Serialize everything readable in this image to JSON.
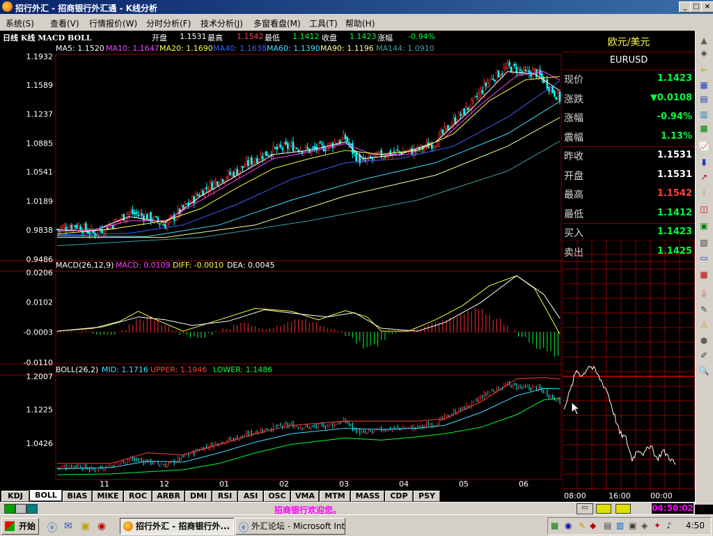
{
  "window": {
    "title": "招行外汇 - 招商银行外汇通 - K线分析",
    "controls": [
      "_",
      "□",
      "×"
    ]
  },
  "menu": [
    {
      "label": "系统(S)"
    },
    {
      "label": "查看(V)"
    },
    {
      "label": "行情报价(W)"
    },
    {
      "label": "分时分析(F)"
    },
    {
      "label": "技术分析(J)"
    },
    {
      "label": "多窗看盘(M)"
    },
    {
      "label": "工具(T)"
    },
    {
      "label": "帮助(H)"
    }
  ],
  "chart_header": {
    "title": "日线 K线 MACD BOLL",
    "open_label": "开盘",
    "open": "1.1531",
    "high_label": "最高",
    "high": "1.1542",
    "low_label": "最低",
    "low": "1.1412",
    "close_label": "收盘",
    "close": "1.1423",
    "change_label": "涨幅",
    "change": "-0.94%"
  },
  "colors": {
    "up": "#ff3030",
    "down": "#00ffff",
    "ma5": "#ffffff",
    "ma10": "#ff40ff",
    "ma20": "#ffff40",
    "ma40": "#4060ff",
    "ma60": "#40e0ff",
    "ma90": "#ffffa0",
    "ma144": "#40a0a0",
    "grid": "#8b0000",
    "green": "#00ff40",
    "red_text": "#ff4040"
  },
  "ma_legend": [
    {
      "label": "MA5: 1.1520",
      "color": "#ffffff"
    },
    {
      "label": "MA10: 1.1647",
      "color": "#ff40ff"
    },
    {
      "label": "MA20: 1.1690",
      "color": "#ffff40"
    },
    {
      "label": "MA40: 1.1638",
      "color": "#4060ff"
    },
    {
      "label": "MA60: 1.1390",
      "color": "#40e0ff"
    },
    {
      "label": "MA90: 1.1196",
      "color": "#ffffa0"
    },
    {
      "label": "MA144: 1.0910",
      "color": "#40a0a0"
    }
  ],
  "macd_legend": {
    "name": "MACD(26,12,9)",
    "macd": "MACD: 0.0109",
    "diff": "DIFF: -0.0010",
    "dea": "DEA: 0.0045"
  },
  "boll_legend": {
    "name": "BOLL(26,2)",
    "mid": "MID: 1.1716",
    "upper": "UPPER: 1.1946",
    "lower": "LOWER: 1.1486"
  },
  "chart_data": [
    {
      "type": "candlestick",
      "title": "日线 K线",
      "yticks": [
        "1.1932",
        "1.1589",
        "1.1237",
        "1.0885",
        "1.0541",
        "1.0189",
        "0.9838",
        "0.9486"
      ],
      "ylim": [
        0.9486,
        1.1932
      ],
      "close_points": [
        [
          0,
          0.985
        ],
        [
          10,
          0.99
        ],
        [
          20,
          0.98
        ],
        [
          30,
          0.99
        ],
        [
          40,
          1.005
        ],
        [
          50,
          1.0
        ],
        [
          60,
          0.99
        ],
        [
          70,
          1.01
        ],
        [
          80,
          1.03
        ],
        [
          90,
          1.045
        ],
        [
          100,
          1.055
        ],
        [
          110,
          1.07
        ],
        [
          120,
          1.08
        ],
        [
          130,
          1.085
        ],
        [
          140,
          1.08
        ],
        [
          150,
          1.085
        ],
        [
          160,
          1.095
        ],
        [
          165,
          1.075
        ],
        [
          170,
          1.065
        ],
        [
          180,
          1.075
        ],
        [
          190,
          1.078
        ],
        [
          200,
          1.08
        ],
        [
          210,
          1.09
        ],
        [
          220,
          1.115
        ],
        [
          230,
          1.135
        ],
        [
          240,
          1.165
        ],
        [
          250,
          1.18
        ],
        [
          255,
          1.178
        ],
        [
          260,
          1.172
        ],
        [
          265,
          1.175
        ],
        [
          270,
          1.165
        ],
        [
          275,
          1.152
        ],
        [
          279,
          1.1423
        ]
      ],
      "ma_lines": [
        {
          "name": "MA5",
          "points": [
            [
              0,
              0.984
            ],
            [
              20,
              0.983
            ],
            [
              40,
              1.0
            ],
            [
              60,
              0.993
            ],
            [
              80,
              1.025
            ],
            [
              100,
              1.05
            ],
            [
              120,
              1.075
            ],
            [
              140,
              1.08
            ],
            [
              160,
              1.09
            ],
            [
              170,
              1.07
            ],
            [
              190,
              1.075
            ],
            [
              210,
              1.09
            ],
            [
              230,
              1.13
            ],
            [
              250,
              1.175
            ],
            [
              265,
              1.172
            ],
            [
              279,
              1.152
            ]
          ]
        },
        {
          "name": "MA10",
          "points": [
            [
              0,
              0.982
            ],
            [
              20,
              0.984
            ],
            [
              40,
              0.995
            ],
            [
              60,
              0.995
            ],
            [
              80,
              1.02
            ],
            [
              100,
              1.045
            ],
            [
              120,
              1.07
            ],
            [
              140,
              1.078
            ],
            [
              160,
              1.088
            ],
            [
              175,
              1.075
            ],
            [
              195,
              1.075
            ],
            [
              215,
              1.095
            ],
            [
              235,
              1.135
            ],
            [
              255,
              1.17
            ],
            [
              270,
              1.175
            ],
            [
              279,
              1.1647
            ]
          ]
        },
        {
          "name": "MA20",
          "points": [
            [
              0,
              0.979
            ],
            [
              30,
              0.985
            ],
            [
              60,
              0.995
            ],
            [
              80,
              1.01
            ],
            [
              100,
              1.035
            ],
            [
              120,
              1.058
            ],
            [
              140,
              1.07
            ],
            [
              160,
              1.08
            ],
            [
              180,
              1.075
            ],
            [
              200,
              1.08
            ],
            [
              220,
              1.1
            ],
            [
              240,
              1.14
            ],
            [
              260,
              1.165
            ],
            [
              279,
              1.169
            ]
          ]
        },
        {
          "name": "MA40",
          "points": [
            [
              0,
              0.978
            ],
            [
              40,
              0.98
            ],
            [
              70,
              0.99
            ],
            [
              100,
              1.015
            ],
            [
              130,
              1.045
            ],
            [
              160,
              1.065
            ],
            [
              190,
              1.07
            ],
            [
              220,
              1.085
            ],
            [
              250,
              1.12
            ],
            [
              279,
              1.1638
            ]
          ]
        },
        {
          "name": "MA60",
          "points": [
            [
              0,
              0.977
            ],
            [
              50,
              0.976
            ],
            [
              90,
              0.99
            ],
            [
              130,
              1.02
            ],
            [
              170,
              1.045
            ],
            [
              210,
              1.065
            ],
            [
              250,
              1.1
            ],
            [
              279,
              1.139
            ]
          ]
        },
        {
          "name": "MA90",
          "points": [
            [
              0,
              0.975
            ],
            [
              60,
              0.975
            ],
            [
              110,
              0.99
            ],
            [
              160,
              1.025
            ],
            [
              210,
              1.05
            ],
            [
              250,
              1.085
            ],
            [
              279,
              1.1196
            ]
          ]
        },
        {
          "name": "MA144",
          "points": [
            [
              0,
              0.965
            ],
            [
              80,
              0.975
            ],
            [
              140,
              0.995
            ],
            [
              200,
              1.02
            ],
            [
              250,
              1.055
            ],
            [
              279,
              1.091
            ]
          ]
        }
      ]
    },
    {
      "type": "bar",
      "title": "MACD(26,12,9)",
      "yticks": [
        "0.0206",
        "0.0102",
        "-0.0003",
        "-0.0110"
      ],
      "ylim": [
        -0.011,
        0.0206
      ],
      "series": [
        {
          "name": "DIFF",
          "points": [
            [
              0,
              0.0
            ],
            [
              20,
              0.001
            ],
            [
              35,
              0.0035
            ],
            [
              45,
              0.007
            ],
            [
              55,
              0.004
            ],
            [
              70,
              0.0
            ],
            [
              90,
              0.004
            ],
            [
              110,
              0.008
            ],
            [
              130,
              0.007
            ],
            [
              145,
              0.004
            ],
            [
              160,
              0.0072
            ],
            [
              172,
              0.005
            ],
            [
              180,
              0.0
            ],
            [
              195,
              0.0
            ],
            [
              210,
              0.004
            ],
            [
              225,
              0.009
            ],
            [
              240,
              0.016
            ],
            [
              255,
              0.0195
            ],
            [
              265,
              0.015
            ],
            [
              279,
              -0.001
            ]
          ]
        },
        {
          "name": "DEA",
          "points": [
            [
              0,
              0.0
            ],
            [
              25,
              0.0015
            ],
            [
              45,
              0.005
            ],
            [
              60,
              0.004
            ],
            [
              75,
              0.002
            ],
            [
              95,
              0.0035
            ],
            [
              115,
              0.0075
            ],
            [
              135,
              0.006
            ],
            [
              150,
              0.005
            ],
            [
              165,
              0.0065
            ],
            [
              180,
              0.001
            ],
            [
              200,
              0.0
            ],
            [
              215,
              0.003
            ],
            [
              235,
              0.01
            ],
            [
              255,
              0.0195
            ],
            [
              270,
              0.013
            ],
            [
              279,
              0.0045
            ]
          ]
        }
      ],
      "macd_bars": [
        0.0,
        0.0,
        0.0,
        0.0,
        -0.001,
        -0.001,
        -0.001,
        0.0,
        0.002,
        0.004,
        0.005,
        0.004,
        0.002,
        0.0,
        -0.001,
        -0.002,
        -0.002,
        -0.001,
        0.0,
        0.001,
        0.002,
        0.003,
        0.002,
        0.001,
        0.001,
        0.002,
        0.003,
        0.004,
        0.004,
        0.003,
        0.002,
        0.001,
        0.0,
        -0.002,
        -0.004,
        -0.006,
        -0.005,
        -0.003,
        -0.001,
        0.0,
        0.0,
        0.001,
        0.002,
        0.003,
        0.004,
        0.005,
        0.006,
        0.007,
        0.008,
        0.006,
        0.004,
        0.002,
        0.0,
        -0.002,
        -0.004,
        -0.006,
        -0.007,
        -0.009
      ]
    },
    {
      "type": "line",
      "title": "BOLL(26,2)",
      "yticks": [
        "1.2007",
        "1.1225",
        "1.0426"
      ],
      "ylim": [
        0.96,
        1.2007
      ],
      "series": [
        {
          "name": "UPPER",
          "points": [
            [
              0,
              0.995
            ],
            [
              30,
              0.995
            ],
            [
              50,
              1.02
            ],
            [
              70,
              1.015
            ],
            [
              90,
              1.04
            ],
            [
              110,
              1.065
            ],
            [
              130,
              1.085
            ],
            [
              160,
              1.095
            ],
            [
              180,
              1.095
            ],
            [
              200,
              1.095
            ],
            [
              215,
              1.1
            ],
            [
              235,
              1.14
            ],
            [
              255,
              1.195
            ],
            [
              270,
              1.198
            ],
            [
              279,
              1.1946
            ]
          ]
        },
        {
          "name": "MID",
          "points": [
            [
              0,
              0.982
            ],
            [
              30,
              0.985
            ],
            [
              50,
              1.0
            ],
            [
              70,
              0.998
            ],
            [
              90,
              1.02
            ],
            [
              110,
              1.045
            ],
            [
              130,
              1.065
            ],
            [
              160,
              1.078
            ],
            [
              180,
              1.075
            ],
            [
              200,
              1.078
            ],
            [
              215,
              1.085
            ],
            [
              235,
              1.115
            ],
            [
              255,
              1.155
            ],
            [
              270,
              1.172
            ],
            [
              279,
              1.1716
            ]
          ]
        },
        {
          "name": "LOWER",
          "points": [
            [
              0,
              0.968
            ],
            [
              30,
              0.97
            ],
            [
              50,
              0.975
            ],
            [
              70,
              0.98
            ],
            [
              90,
              0.995
            ],
            [
              110,
              1.02
            ],
            [
              130,
              1.04
            ],
            [
              160,
              1.055
            ],
            [
              180,
              1.05
            ],
            [
              200,
              1.058
            ],
            [
              215,
              1.065
            ],
            [
              235,
              1.08
            ],
            [
              255,
              1.11
            ],
            [
              270,
              1.145
            ],
            [
              279,
              1.1486
            ]
          ]
        }
      ]
    }
  ],
  "xaxis_months": [
    "11",
    "12",
    "01",
    "02",
    "03",
    "04",
    "05",
    "06"
  ],
  "quote": {
    "pair_cn": "欧元/美元",
    "pair_code": "EURUSD",
    "rows": [
      {
        "label": "现价",
        "value": "1.1423",
        "color": "#00ff40"
      },
      {
        "label": "涨跌",
        "value": "▼0.0108",
        "color": "#00ff40"
      },
      {
        "label": "涨幅",
        "value": "-0.94%",
        "color": "#00ff40"
      },
      {
        "label": "震幅",
        "value": "1.13%",
        "color": "#00ff40"
      },
      {
        "label": "昨收",
        "value": "1.1531",
        "color": "#ffffff"
      },
      {
        "label": "开盘",
        "value": "1.1531",
        "color": "#ffffff"
      },
      {
        "label": "最高",
        "value": "1.1542",
        "color": "#ff4040"
      },
      {
        "label": "最低",
        "value": "1.1412",
        "color": "#00ff40"
      },
      {
        "label": "买入",
        "value": "1.1423",
        "color": "#00ff40"
      },
      {
        "label": "卖出",
        "value": "1.1425",
        "color": "#00ff40"
      }
    ]
  },
  "intraday": {
    "time_labels": [
      "08:00",
      "16:00",
      "00:00"
    ],
    "points": [
      [
        0,
        0.6
      ],
      [
        5,
        0.75
      ],
      [
        10,
        0.95
      ],
      [
        15,
        0.9
      ],
      [
        20,
        1.0
      ],
      [
        25,
        0.95
      ],
      [
        30,
        0.85
      ],
      [
        35,
        0.75
      ],
      [
        40,
        0.55
      ],
      [
        45,
        0.35
      ],
      [
        50,
        0.3
      ],
      [
        55,
        0.1
      ],
      [
        60,
        0.2
      ],
      [
        65,
        0.15
      ],
      [
        70,
        0.25
      ],
      [
        75,
        0.1
      ],
      [
        80,
        0.18
      ],
      [
        85,
        0.12
      ],
      [
        90,
        0.05
      ]
    ]
  },
  "tabs": [
    "KDJ",
    "BOLL",
    "BIAS",
    "MIKE",
    "ROC",
    "ARBR",
    "DMI",
    "RSI",
    "ASI",
    "OSC",
    "VMA",
    "MTM",
    "MASS",
    "CDP",
    "PSY"
  ],
  "active_tab": "BOLL",
  "status": {
    "message": "招商银行欢迎您。",
    "clock": "04:50:02"
  },
  "taskbar": {
    "start_label": "开始",
    "tasks": [
      {
        "label": "招行外汇 - 招商银行外..."
      },
      {
        "label": "外汇论坛 - Microsoft Int..."
      }
    ],
    "clock": "4:50"
  }
}
